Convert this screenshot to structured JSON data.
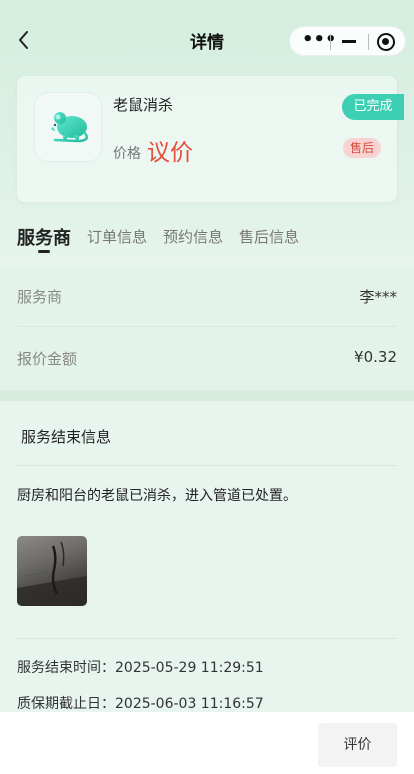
{
  "header": {
    "title": "详情"
  },
  "service": {
    "name": "老鼠消杀",
    "price_label": "价格",
    "price_value": "议价",
    "status": "已完成",
    "after_sale_badge": "售后"
  },
  "tabs": [
    {
      "label": "服务商",
      "active": true
    },
    {
      "label": "订单信息",
      "active": false
    },
    {
      "label": "预约信息",
      "active": false
    },
    {
      "label": "售后信息",
      "active": false
    }
  ],
  "provider": {
    "rows": [
      {
        "label": "服务商",
        "value": "李***"
      },
      {
        "label": "报价金额",
        "value": "¥0.32"
      }
    ]
  },
  "service_end": {
    "title": "服务结束信息",
    "description": "厨房和阳台的老鼠已消杀，进入管道已处置。",
    "end_time": "服务结束时间：2025-05-29 11:29:51",
    "warranty_end": "质保期截止日：2025-06-03 11:16:57"
  },
  "footer": {
    "rate_label": "评价"
  },
  "colors": {
    "accent": "#3ccfb3",
    "price": "#e84d3d",
    "background": "#e8f4ee"
  },
  "icons": {
    "back": "chevron-left-icon",
    "more": "more-dots-icon",
    "minimize": "minimize-icon",
    "home": "target-icon",
    "service_thumb": "mouse-icon"
  }
}
